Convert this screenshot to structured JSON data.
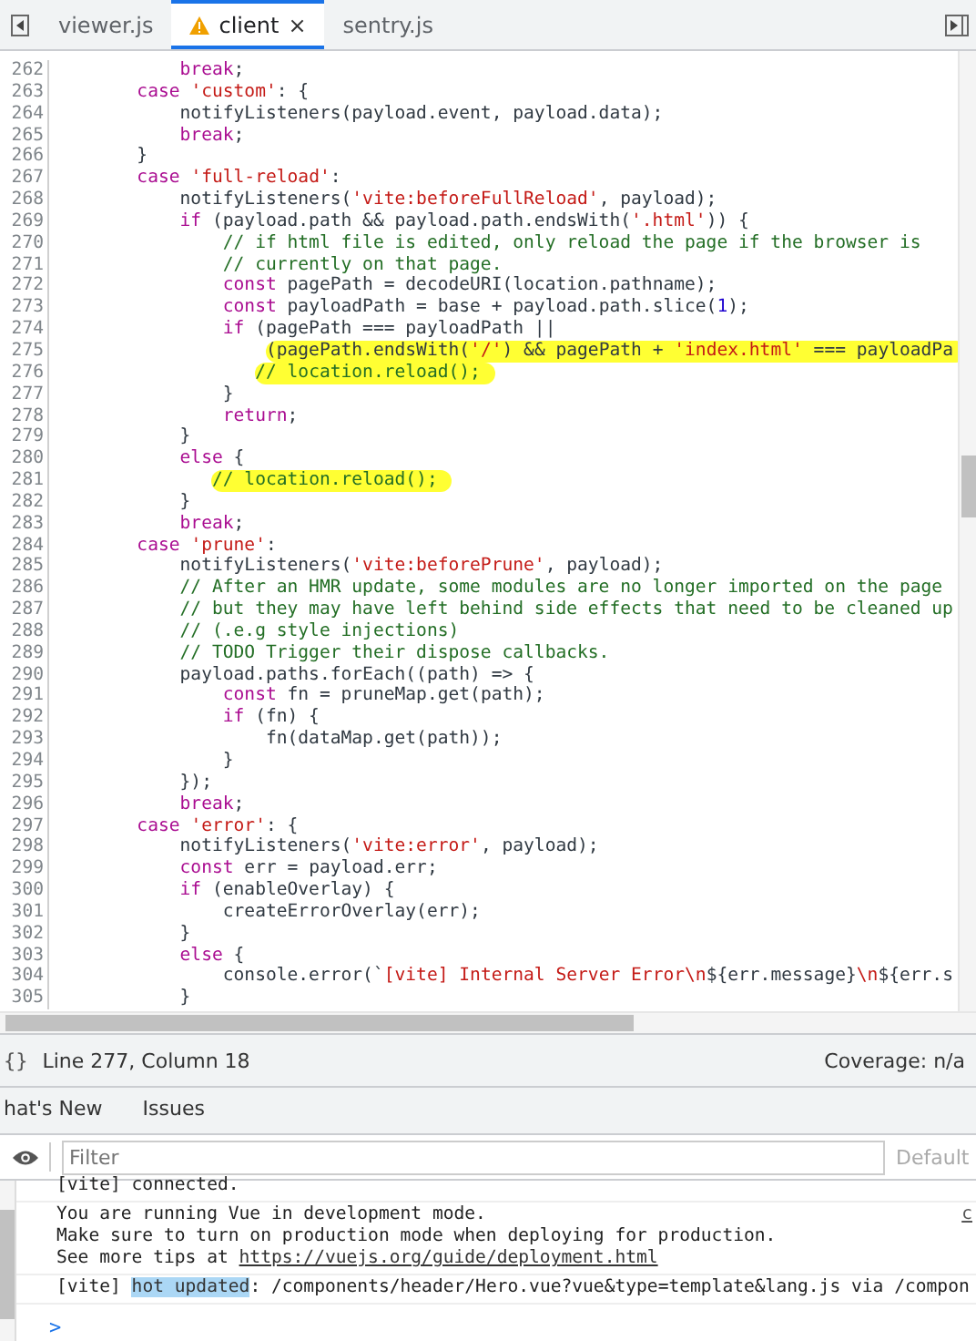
{
  "tabs": [
    {
      "label": "viewer.js",
      "selected": false,
      "warning": false
    },
    {
      "label": "client",
      "selected": true,
      "warning": true,
      "close": "×"
    },
    {
      "label": "sentry.js",
      "selected": false,
      "warning": false
    }
  ],
  "editor": {
    "lines": [
      {
        "number": "262",
        "highlighted": false,
        "tokens": [
          {
            "kind": "keyword",
            "text": "            break"
          },
          {
            "kind": "plain",
            "text": ";"
          }
        ]
      },
      {
        "number": "263",
        "highlighted": false,
        "tokens": [
          {
            "kind": "keyword",
            "text": "        case "
          },
          {
            "kind": "string",
            "text": "'custom'"
          },
          {
            "kind": "plain",
            "text": ": {"
          }
        ]
      },
      {
        "number": "264",
        "highlighted": false,
        "tokens": [
          {
            "kind": "plain",
            "text": "            notifyListeners(payload.event, payload.data);"
          }
        ]
      },
      {
        "number": "265",
        "highlighted": false,
        "tokens": [
          {
            "kind": "keyword",
            "text": "            break"
          },
          {
            "kind": "plain",
            "text": ";"
          }
        ]
      },
      {
        "number": "266",
        "highlighted": false,
        "tokens": [
          {
            "kind": "plain",
            "text": "        }"
          }
        ]
      },
      {
        "number": "267",
        "highlighted": false,
        "tokens": [
          {
            "kind": "keyword",
            "text": "        case "
          },
          {
            "kind": "string",
            "text": "'full-reload'"
          },
          {
            "kind": "plain",
            "text": ":"
          }
        ]
      },
      {
        "number": "268",
        "highlighted": false,
        "tokens": [
          {
            "kind": "plain",
            "text": "            notifyListeners("
          },
          {
            "kind": "string",
            "text": "'vite:beforeFullReload'"
          },
          {
            "kind": "plain",
            "text": ", payload);"
          }
        ]
      },
      {
        "number": "269",
        "highlighted": false,
        "tokens": [
          {
            "kind": "keyword",
            "text": "            if"
          },
          {
            "kind": "plain",
            "text": " (payload.path && payload.path.endsWith("
          },
          {
            "kind": "string",
            "text": "'.html'"
          },
          {
            "kind": "plain",
            "text": ")) {"
          }
        ]
      },
      {
        "number": "270",
        "highlighted": false,
        "tokens": [
          {
            "kind": "comment",
            "text": "                // if html file is edited, only reload the page if the browser is"
          }
        ]
      },
      {
        "number": "271",
        "highlighted": false,
        "tokens": [
          {
            "kind": "comment",
            "text": "                // currently on that page."
          }
        ]
      },
      {
        "number": "272",
        "highlighted": false,
        "tokens": [
          {
            "kind": "keyword",
            "text": "                const"
          },
          {
            "kind": "plain",
            "text": " pagePath = decodeURI(location.pathname);"
          }
        ]
      },
      {
        "number": "273",
        "highlighted": false,
        "tokens": [
          {
            "kind": "keyword",
            "text": "                const"
          },
          {
            "kind": "plain",
            "text": " payloadPath = base + payload.path.slice("
          },
          {
            "kind": "number",
            "text": "1"
          },
          {
            "kind": "plain",
            "text": ");"
          }
        ]
      },
      {
        "number": "274",
        "highlighted": false,
        "tokens": [
          {
            "kind": "keyword",
            "text": "                if"
          },
          {
            "kind": "plain",
            "text": " (pagePath === payloadPath ||"
          }
        ]
      },
      {
        "number": "275",
        "highlighted": true,
        "tokens": [
          {
            "kind": "plain",
            "text": "                    (pagePath.endsWith("
          },
          {
            "kind": "string",
            "text": "'/'"
          },
          {
            "kind": "plain",
            "text": ") && pagePath + "
          },
          {
            "kind": "string",
            "text": "'index.html'"
          },
          {
            "kind": "plain",
            "text": " === payloadPa"
          }
        ]
      },
      {
        "number": "276",
        "highlighted": true,
        "tokens": [
          {
            "kind": "comment",
            "text": "                   // location.reload();"
          }
        ]
      },
      {
        "number": "277",
        "highlighted": false,
        "tokens": [
          {
            "kind": "plain",
            "text": "                }"
          }
        ]
      },
      {
        "number": "278",
        "highlighted": false,
        "tokens": [
          {
            "kind": "keyword",
            "text": "                return"
          },
          {
            "kind": "plain",
            "text": ";"
          }
        ]
      },
      {
        "number": "279",
        "highlighted": false,
        "tokens": [
          {
            "kind": "plain",
            "text": "            }"
          }
        ]
      },
      {
        "number": "280",
        "highlighted": false,
        "tokens": [
          {
            "kind": "keyword",
            "text": "            else"
          },
          {
            "kind": "plain",
            "text": " {"
          }
        ]
      },
      {
        "number": "281",
        "highlighted": true,
        "tokens": [
          {
            "kind": "comment",
            "text": "               // location.reload();"
          }
        ]
      },
      {
        "number": "282",
        "highlighted": false,
        "tokens": [
          {
            "kind": "plain",
            "text": "            }"
          }
        ]
      },
      {
        "number": "283",
        "highlighted": false,
        "tokens": [
          {
            "kind": "keyword",
            "text": "            break"
          },
          {
            "kind": "plain",
            "text": ";"
          }
        ]
      },
      {
        "number": "284",
        "highlighted": false,
        "tokens": [
          {
            "kind": "keyword",
            "text": "        case "
          },
          {
            "kind": "string",
            "text": "'prune'"
          },
          {
            "kind": "plain",
            "text": ":"
          }
        ]
      },
      {
        "number": "285",
        "highlighted": false,
        "tokens": [
          {
            "kind": "plain",
            "text": "            notifyListeners("
          },
          {
            "kind": "string",
            "text": "'vite:beforePrune'"
          },
          {
            "kind": "plain",
            "text": ", payload);"
          }
        ]
      },
      {
        "number": "286",
        "highlighted": false,
        "tokens": [
          {
            "kind": "comment",
            "text": "            // After an HMR update, some modules are no longer imported on the page"
          }
        ]
      },
      {
        "number": "287",
        "highlighted": false,
        "tokens": [
          {
            "kind": "comment",
            "text": "            // but they may have left behind side effects that need to be cleaned up"
          }
        ]
      },
      {
        "number": "288",
        "highlighted": false,
        "tokens": [
          {
            "kind": "comment",
            "text": "            // (.e.g style injections)"
          }
        ]
      },
      {
        "number": "289",
        "highlighted": false,
        "tokens": [
          {
            "kind": "comment",
            "text": "            // TODO Trigger their dispose callbacks."
          }
        ]
      },
      {
        "number": "290",
        "highlighted": false,
        "tokens": [
          {
            "kind": "plain",
            "text": "            payload.paths.forEach((path) => {"
          }
        ]
      },
      {
        "number": "291",
        "highlighted": false,
        "tokens": [
          {
            "kind": "keyword",
            "text": "                const"
          },
          {
            "kind": "plain",
            "text": " fn = pruneMap.get(path);"
          }
        ]
      },
      {
        "number": "292",
        "highlighted": false,
        "tokens": [
          {
            "kind": "keyword",
            "text": "                if"
          },
          {
            "kind": "plain",
            "text": " (fn) {"
          }
        ]
      },
      {
        "number": "293",
        "highlighted": false,
        "tokens": [
          {
            "kind": "plain",
            "text": "                    fn(dataMap.get(path));"
          }
        ]
      },
      {
        "number": "294",
        "highlighted": false,
        "tokens": [
          {
            "kind": "plain",
            "text": "                }"
          }
        ]
      },
      {
        "number": "295",
        "highlighted": false,
        "tokens": [
          {
            "kind": "plain",
            "text": "            });"
          }
        ]
      },
      {
        "number": "296",
        "highlighted": false,
        "tokens": [
          {
            "kind": "keyword",
            "text": "            break"
          },
          {
            "kind": "plain",
            "text": ";"
          }
        ]
      },
      {
        "number": "297",
        "highlighted": false,
        "tokens": [
          {
            "kind": "keyword",
            "text": "        case "
          },
          {
            "kind": "string",
            "text": "'error'"
          },
          {
            "kind": "plain",
            "text": ": {"
          }
        ]
      },
      {
        "number": "298",
        "highlighted": false,
        "tokens": [
          {
            "kind": "plain",
            "text": "            notifyListeners("
          },
          {
            "kind": "string",
            "text": "'vite:error'"
          },
          {
            "kind": "plain",
            "text": ", payload);"
          }
        ]
      },
      {
        "number": "299",
        "highlighted": false,
        "tokens": [
          {
            "kind": "keyword",
            "text": "            const"
          },
          {
            "kind": "plain",
            "text": " err = payload.err;"
          }
        ]
      },
      {
        "number": "300",
        "highlighted": false,
        "tokens": [
          {
            "kind": "keyword",
            "text": "            if"
          },
          {
            "kind": "plain",
            "text": " (enableOverlay) {"
          }
        ]
      },
      {
        "number": "301",
        "highlighted": false,
        "tokens": [
          {
            "kind": "plain",
            "text": "                createErrorOverlay(err);"
          }
        ]
      },
      {
        "number": "302",
        "highlighted": false,
        "tokens": [
          {
            "kind": "plain",
            "text": "            }"
          }
        ]
      },
      {
        "number": "303",
        "highlighted": false,
        "tokens": [
          {
            "kind": "keyword",
            "text": "            else"
          },
          {
            "kind": "plain",
            "text": " {"
          }
        ]
      },
      {
        "number": "304",
        "highlighted": false,
        "tokens": [
          {
            "kind": "plain",
            "text": "                console.error(`"
          },
          {
            "kind": "string",
            "text": "[vite] Internal Server Error\\n"
          },
          {
            "kind": "plain",
            "text": "${err.message}"
          },
          {
            "kind": "string",
            "text": "\\n"
          },
          {
            "kind": "plain",
            "text": "${err.s"
          }
        ]
      },
      {
        "number": "305",
        "highlighted": false,
        "tokens": [
          {
            "kind": "plain",
            "text": "            }"
          }
        ]
      }
    ]
  },
  "status_bar": {
    "format_button": "{}",
    "position": "Line 277, Column 18",
    "coverage": "Coverage: n/a"
  },
  "drawer_tabs": [
    {
      "label": "hat's New",
      "selected": false
    },
    {
      "label": "Issues",
      "selected": false
    }
  ],
  "console": {
    "filter": {
      "placeholder": "Filter"
    },
    "levels": "Default",
    "messages": [
      {
        "lines": [
          [
            {
              "kind": "plain",
              "text": "[vite] connected."
            }
          ]
        ]
      },
      {
        "source": "c",
        "lines": [
          [
            {
              "kind": "plain",
              "text": "You are running Vue in development mode."
            }
          ],
          [
            {
              "kind": "plain",
              "text": "Make sure to turn on production mode when deploying for production."
            }
          ],
          [
            {
              "kind": "plain",
              "text": "See more tips at "
            },
            {
              "kind": "link",
              "text": "https://vuejs.org/guide/deployment.html"
            }
          ]
        ]
      },
      {
        "lines": [
          [
            {
              "kind": "plain",
              "text": "[vite] "
            },
            {
              "kind": "match",
              "text": "hot updated"
            },
            {
              "kind": "plain",
              "text": ": /components/header/Hero.vue?vue&type=template&lang.js via /compon"
            }
          ]
        ]
      }
    ],
    "prompt": ">"
  }
}
